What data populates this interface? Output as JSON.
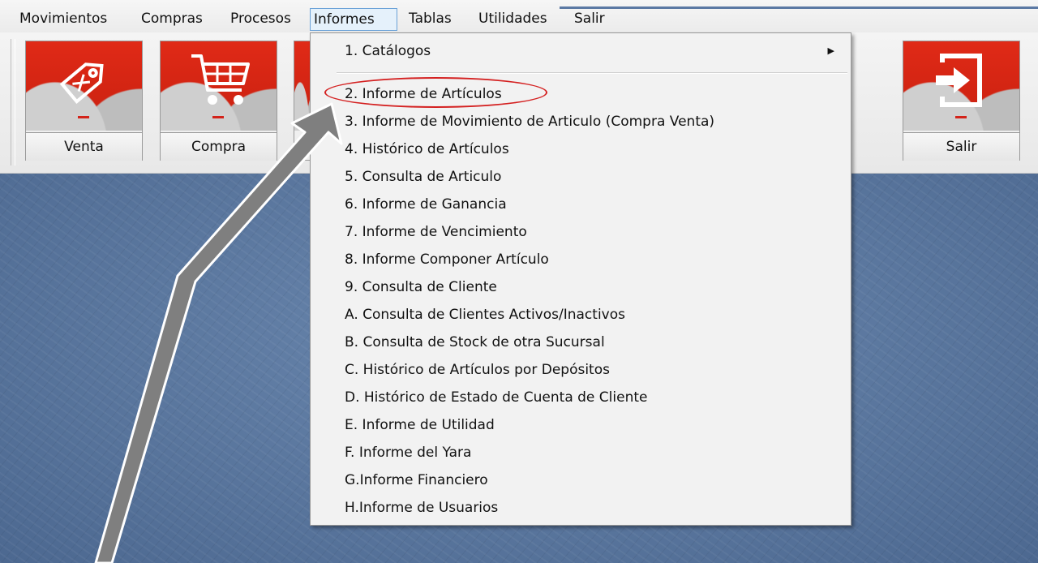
{
  "menubar": {
    "items": [
      {
        "label": "Movimientos"
      },
      {
        "label": "Compras"
      },
      {
        "label": "Procesos"
      },
      {
        "label": "Informes"
      },
      {
        "label": "Tablas"
      },
      {
        "label": "Utilidades"
      },
      {
        "label": "Salir"
      }
    ],
    "active": "Informes"
  },
  "toolbar": {
    "buttons": [
      {
        "label": "Venta",
        "icon": "price-tag-icon"
      },
      {
        "label": "Compra",
        "icon": "shopping-cart-icon"
      },
      {
        "label": "Salir",
        "icon": "exit-icon"
      }
    ]
  },
  "informes_menu": {
    "items": [
      {
        "label": "1. Catálogos",
        "submenu": true
      },
      {
        "label": "2. Informe de Artículos",
        "highlighted": true
      },
      {
        "label": "3. Informe de Movimiento de Articulo  (Compra Venta)"
      },
      {
        "label": "4. Histórico de Artículos"
      },
      {
        "label": "5. Consulta de Articulo"
      },
      {
        "label": "6. Informe de Ganancia"
      },
      {
        "label": "7. Informe de Vencimiento"
      },
      {
        "label": "8. Informe Componer Artículo"
      },
      {
        "label": "9. Consulta de Cliente"
      },
      {
        "label": "A. Consulta de Clientes Activos/Inactivos"
      },
      {
        "label": "B. Consulta de Stock de otra Sucursal"
      },
      {
        "label": "C. Histórico de Artículos por Depósitos"
      },
      {
        "label": "D. Histórico de Estado de Cuenta de Cliente"
      },
      {
        "label": "E. Informe de Utilidad"
      },
      {
        "label": "F. Informe del Yara"
      },
      {
        "label": "G.Informe Financiero"
      },
      {
        "label": "H.Informe de Usuarios"
      }
    ]
  },
  "colors": {
    "desktop": "#4f6b92",
    "button_red": "#d8251a",
    "highlight": "#d42020",
    "arrow": "#808080"
  }
}
